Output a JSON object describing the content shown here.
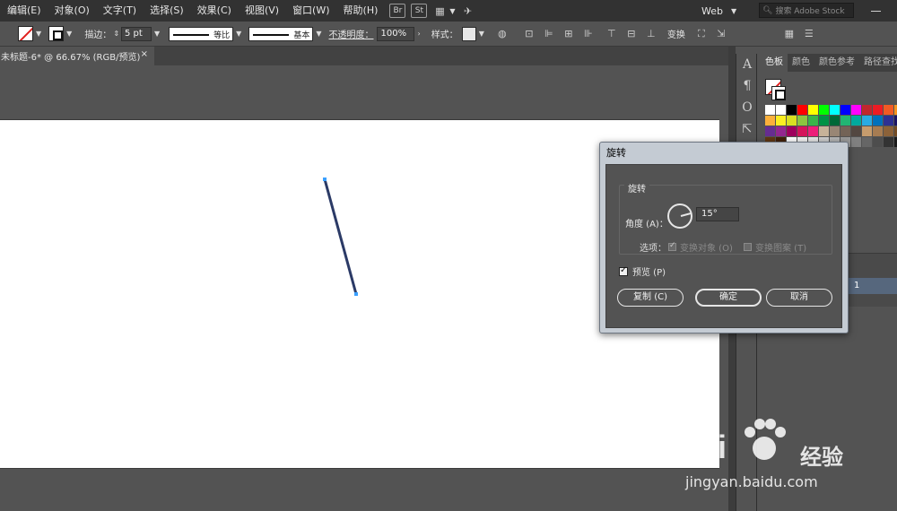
{
  "menu": {
    "items": [
      "编辑(E)",
      "对象(O)",
      "文字(T)",
      "选择(S)",
      "效果(C)",
      "视图(V)",
      "窗口(W)",
      "帮助(H)"
    ],
    "app_chips": [
      "Br",
      "St"
    ],
    "workspace": "Web",
    "stock_search_placeholder": "搜索 Adobe Stock"
  },
  "control_bar": {
    "stroke_label": "描边：",
    "stroke_weight": "5 pt",
    "profile_label": "等比",
    "brush_label": "基本",
    "opacity_label": "不透明度：",
    "opacity_value": "100%",
    "style_label": "样式：",
    "transform_label": "变换"
  },
  "document": {
    "tab_title": "未标题-6* @ 66.67% (RGB/预览)",
    "tab_close": "×"
  },
  "panels": {
    "tabs": [
      "色板",
      "颜色",
      "颜色参考",
      "路径查找"
    ],
    "active_tab": "色板",
    "layer_label": "1",
    "swatch_colors": [
      "#ffffff",
      "#ffffff",
      "#000000",
      "#ff0000",
      "#ffff00",
      "#00ff00",
      "#00ffff",
      "#0000ff",
      "#ff00ff",
      "#c1272d",
      "#ed1c24",
      "#f15a24",
      "#f7931e",
      "#fbb03b",
      "#fcee21",
      "#d9e021",
      "#8cc63f",
      "#39b54a",
      "#009245",
      "#006837",
      "#22b573",
      "#00a99d",
      "#29abe2",
      "#0071bc",
      "#2e3192",
      "#1b1464",
      "#662d91",
      "#93278f",
      "#9e005d",
      "#d4145a",
      "#ed1e79",
      "#c7b299",
      "#998675",
      "#736357",
      "#534741",
      "#c69c6d",
      "#a67c52",
      "#8c6239",
      "#754c24",
      "#603813",
      "#42210b",
      "#ffffff",
      "#f2f2f2",
      "#e6e6e6",
      "#cccccc",
      "#b3b3b3",
      "#999999",
      "#808080",
      "#666666",
      "#4d4d4d",
      "#333333",
      "#1a1a1a"
    ]
  },
  "dialog": {
    "title": "旋转",
    "group_title": "旋转",
    "angle_label": "角度 (A)：",
    "angle_value": "15°",
    "options_label": "选项：",
    "option_objects": "变换对象 (O)",
    "option_patterns": "变换图案 (T)",
    "preview_label": "预览 (P)",
    "copy_button": "复制 (C)",
    "ok_button": "确定",
    "cancel_button": "取消"
  },
  "watermark": {
    "brand": "Bai",
    "brand_cn": "经验",
    "url": "jingyan.baidu.com"
  }
}
